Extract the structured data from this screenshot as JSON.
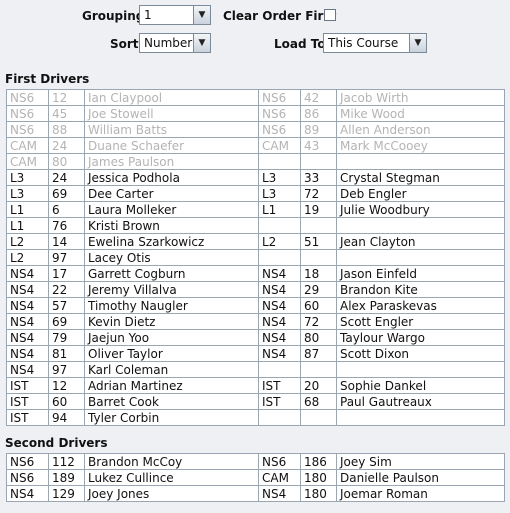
{
  "controls": {
    "grouping_label": "Grouping",
    "grouping_value": "1",
    "clear_order_first_label": "Clear Order First",
    "clear_order_first_checked": false,
    "sort_label": "Sort",
    "sort_value": "Number",
    "load_to_label": "Load To",
    "load_to_value": "This Course"
  },
  "first_drivers": {
    "title": "First Drivers",
    "rows": [
      {
        "dim": true,
        "left": [
          "NS6",
          "12",
          "Ian Claypool"
        ],
        "right": [
          "NS6",
          "42",
          "Jacob Wirth"
        ]
      },
      {
        "dim": true,
        "left": [
          "NS6",
          "45",
          "Joe Stowell"
        ],
        "right": [
          "NS6",
          "86",
          "Mike Wood"
        ]
      },
      {
        "dim": true,
        "left": [
          "NS6",
          "88",
          "William Batts"
        ],
        "right": [
          "NS6",
          "89",
          "Allen Anderson"
        ]
      },
      {
        "dim": true,
        "left": [
          "CAM",
          "24",
          "Duane Schaefer"
        ],
        "right": [
          "CAM",
          "43",
          "Mark McCooey"
        ]
      },
      {
        "dim": true,
        "left": [
          "CAM",
          "80",
          "James Paulson"
        ],
        "right": [
          "",
          "",
          ""
        ]
      },
      {
        "dim": false,
        "left": [
          "L3",
          "24",
          "Jessica Podhola"
        ],
        "right": [
          "L3",
          "33",
          "Crystal Stegman"
        ]
      },
      {
        "dim": false,
        "left": [
          "L3",
          "69",
          "Dee Carter"
        ],
        "right": [
          "L3",
          "72",
          "Deb Engler"
        ]
      },
      {
        "dim": false,
        "left": [
          "L1",
          "6",
          "Laura Molleker"
        ],
        "right": [
          "L1",
          "19",
          "Julie Woodbury"
        ]
      },
      {
        "dim": false,
        "left": [
          "L1",
          "76",
          "Kristi Brown"
        ],
        "right": [
          "",
          "",
          ""
        ]
      },
      {
        "dim": false,
        "left": [
          "L2",
          "14",
          "Ewelina Szarkowicz"
        ],
        "right": [
          "L2",
          "51",
          "Jean Clayton"
        ]
      },
      {
        "dim": false,
        "left": [
          "L2",
          "97",
          "Lacey Otis"
        ],
        "right": [
          "",
          "",
          ""
        ]
      },
      {
        "dim": false,
        "left": [
          "NS4",
          "17",
          "Garrett Cogburn"
        ],
        "right": [
          "NS4",
          "18",
          "Jason Einfeld"
        ]
      },
      {
        "dim": false,
        "left": [
          "NS4",
          "22",
          "Jeremy Villalva"
        ],
        "right": [
          "NS4",
          "29",
          "Brandon Kite"
        ]
      },
      {
        "dim": false,
        "left": [
          "NS4",
          "57",
          "Timothy Naugler"
        ],
        "right": [
          "NS4",
          "60",
          "Alex Paraskevas"
        ]
      },
      {
        "dim": false,
        "left": [
          "NS4",
          "69",
          "Kevin Dietz"
        ],
        "right": [
          "NS4",
          "72",
          "Scott Engler"
        ]
      },
      {
        "dim": false,
        "left": [
          "NS4",
          "79",
          "Jaejun Yoo"
        ],
        "right": [
          "NS4",
          "80",
          "Taylour Wargo"
        ]
      },
      {
        "dim": false,
        "left": [
          "NS4",
          "81",
          "Oliver Taylor"
        ],
        "right": [
          "NS4",
          "87",
          "Scott Dixon"
        ]
      },
      {
        "dim": false,
        "left": [
          "NS4",
          "97",
          "Karl Coleman"
        ],
        "right": [
          "",
          "",
          ""
        ]
      },
      {
        "dim": false,
        "left": [
          "IST",
          "12",
          "Adrian Martinez"
        ],
        "right": [
          "IST",
          "20",
          "Sophie Dankel"
        ]
      },
      {
        "dim": false,
        "left": [
          "IST",
          "60",
          "Barret Cook"
        ],
        "right": [
          "IST",
          "68",
          "Paul Gautreaux"
        ]
      },
      {
        "dim": false,
        "left": [
          "IST",
          "94",
          "Tyler Corbin"
        ],
        "right": [
          "",
          "",
          ""
        ]
      }
    ]
  },
  "second_drivers": {
    "title": "Second Drivers",
    "rows": [
      {
        "dim": false,
        "left": [
          "NS6",
          "112",
          "Brandon McCoy"
        ],
        "right": [
          "NS6",
          "186",
          "Joey Sim"
        ]
      },
      {
        "dim": false,
        "left": [
          "NS6",
          "189",
          "Lukez Cullince"
        ],
        "right": [
          "CAM",
          "180",
          "Danielle Paulson"
        ]
      },
      {
        "dim": false,
        "left": [
          "NS4",
          "129",
          "Joey Jones"
        ],
        "right": [
          "NS4",
          "180",
          "Joemar Roman"
        ]
      }
    ]
  }
}
